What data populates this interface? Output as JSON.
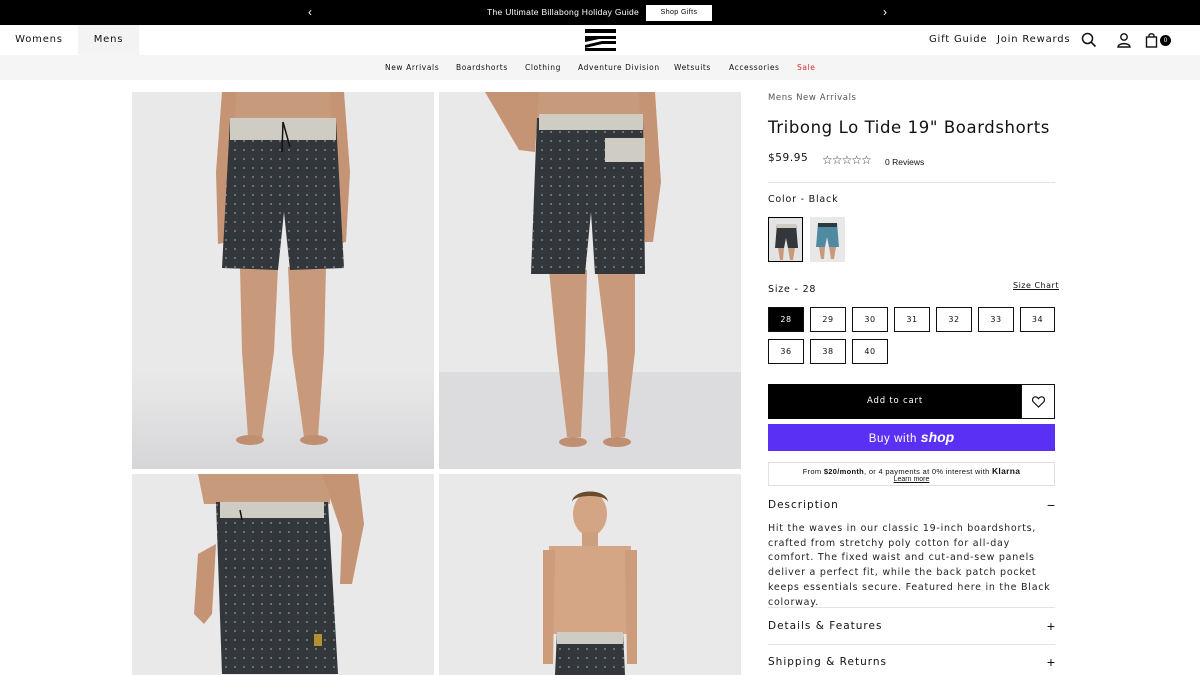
{
  "announcement": {
    "message": "The Ultimate Billabong Holiday Guide",
    "cta": "Shop Gifts",
    "prev_icon": "chevron-left-icon",
    "next_icon": "chevron-right-icon"
  },
  "header": {
    "tabs": [
      "Womens",
      "Mens"
    ],
    "logo": "billabong-logo",
    "links": [
      "Gift Guide",
      "Join Rewards"
    ],
    "cart_count": "0"
  },
  "nav": {
    "items": [
      "New Arrivals",
      "Boardshorts",
      "Clothing",
      "Adventure Division",
      "Wetsuits",
      "Accessories",
      "Sale"
    ]
  },
  "product": {
    "breadcrumb": "Mens New Arrivals",
    "title": "Tribong Lo Tide 19\" Boardshorts",
    "price": "$59.95",
    "rating": 0,
    "reviews": "0 Reviews",
    "color_label": "Color - Black",
    "size_label": "Size - 28",
    "size_chart": "Size Chart",
    "sizes": [
      "28",
      "29",
      "30",
      "31",
      "32",
      "33",
      "34",
      "36",
      "38",
      "40"
    ],
    "selected_size": "28",
    "add_to_cart": "Add to cart",
    "buy_with": "Buy with",
    "shop_brand": "shop",
    "klarna": {
      "prefix": "From ",
      "amount": "$20/month",
      "suffix": ", or 4 payments at 0% interest with ",
      "brand": "Klarna",
      "learn_more": "Learn more"
    },
    "description_heading": "Description",
    "description": "Hit the waves in our classic 19-inch boardshorts, crafted from stretchy poly cotton for all-day comfort. The fixed waist and cut-and-sew panels deliver a perfect fit, while the back patch pocket keeps essentials secure. Featured here in the Black colorway.",
    "details_heading": "Details & Features",
    "shipping_heading": "Shipping & Returns",
    "collapse_symbol": "−",
    "expand_symbol": "+"
  },
  "colors": {
    "accent_shop": "#5a31f4",
    "sale": "#d22f2f",
    "shorts_dark": "#33363b",
    "waistband": "#cfccc3"
  }
}
